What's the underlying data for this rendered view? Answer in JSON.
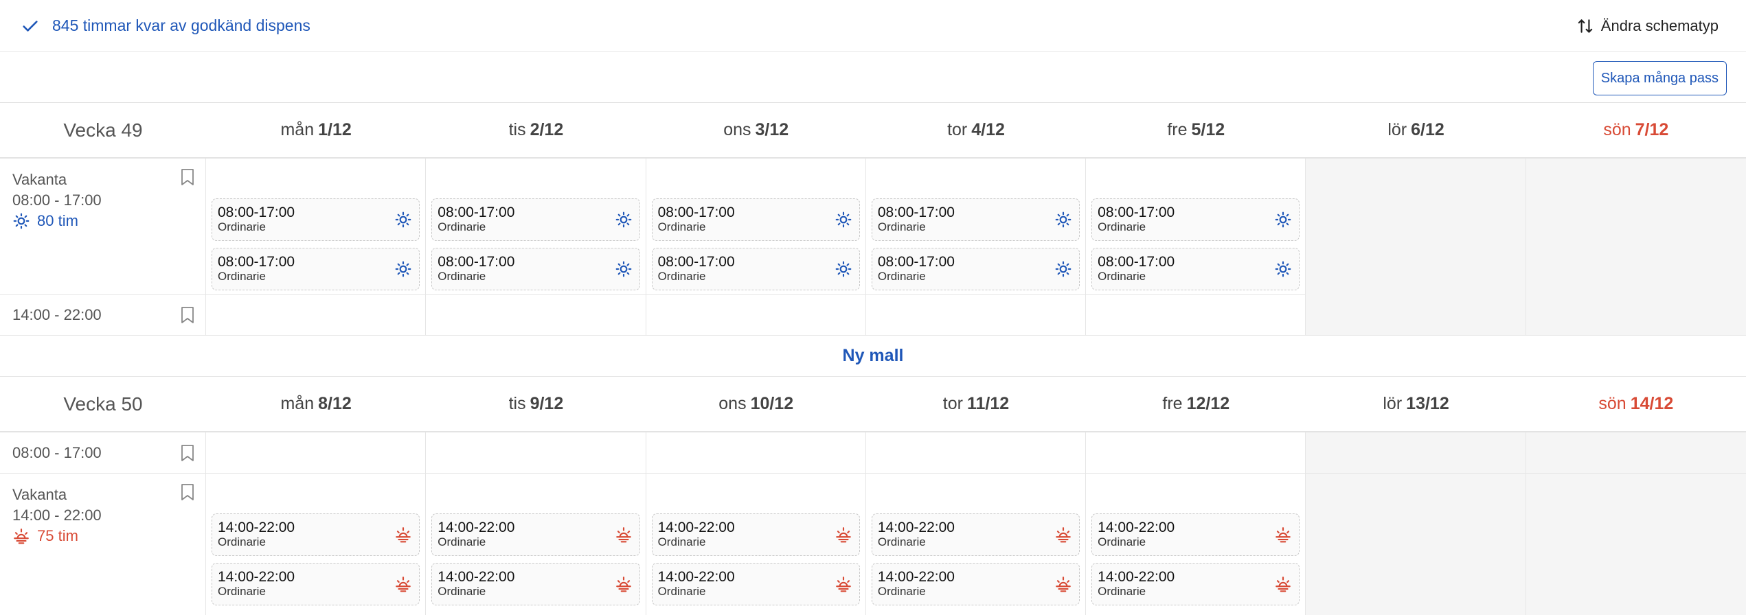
{
  "header": {
    "dispens_text": "845 timmar kvar av godkänd dispens",
    "schema_label": "Ändra schematyp"
  },
  "toolbar": {
    "create_many_label": "Skapa många pass"
  },
  "weeks": [
    {
      "label": "Vecka 49",
      "days": [
        {
          "name": "mån",
          "date": "1/12"
        },
        {
          "name": "tis",
          "date": "2/12"
        },
        {
          "name": "ons",
          "date": "3/12"
        },
        {
          "name": "tor",
          "date": "4/12"
        },
        {
          "name": "fre",
          "date": "5/12"
        },
        {
          "name": "lör",
          "date": "6/12"
        },
        {
          "name": "sön",
          "date": "7/12"
        }
      ],
      "rows": [
        {
          "status": "Vakanta",
          "time_range": "08:00 - 17:00",
          "hours": "80 tim",
          "shift_time": "08:00-17:00",
          "shift_type": "Ordinarie"
        },
        {
          "time_range": "14:00 - 22:00"
        }
      ]
    },
    {
      "label": "Vecka 50",
      "days": [
        {
          "name": "mån",
          "date": "8/12"
        },
        {
          "name": "tis",
          "date": "9/12"
        },
        {
          "name": "ons",
          "date": "10/12"
        },
        {
          "name": "tor",
          "date": "11/12"
        },
        {
          "name": "fre",
          "date": "12/12"
        },
        {
          "name": "lör",
          "date": "13/12"
        },
        {
          "name": "sön",
          "date": "14/12"
        }
      ],
      "rows": [
        {
          "time_range": "08:00 - 17:00"
        },
        {
          "status": "Vakanta",
          "time_range": "14:00 - 22:00",
          "hours": "75 tim",
          "shift_time": "14:00-22:00",
          "shift_type": "Ordinarie"
        }
      ]
    }
  ],
  "new_template_label": "Ny mall",
  "icons": {
    "check": "check-icon",
    "sort": "sort-arrows-icon",
    "bookmark": "bookmark-icon",
    "sun": "sun-icon",
    "sunset": "sunset-icon"
  },
  "colors": {
    "accent": "#1f57b8",
    "sunday": "#d84a35",
    "evening": "#d84a35",
    "weekend_bg": "#f5f5f5"
  }
}
